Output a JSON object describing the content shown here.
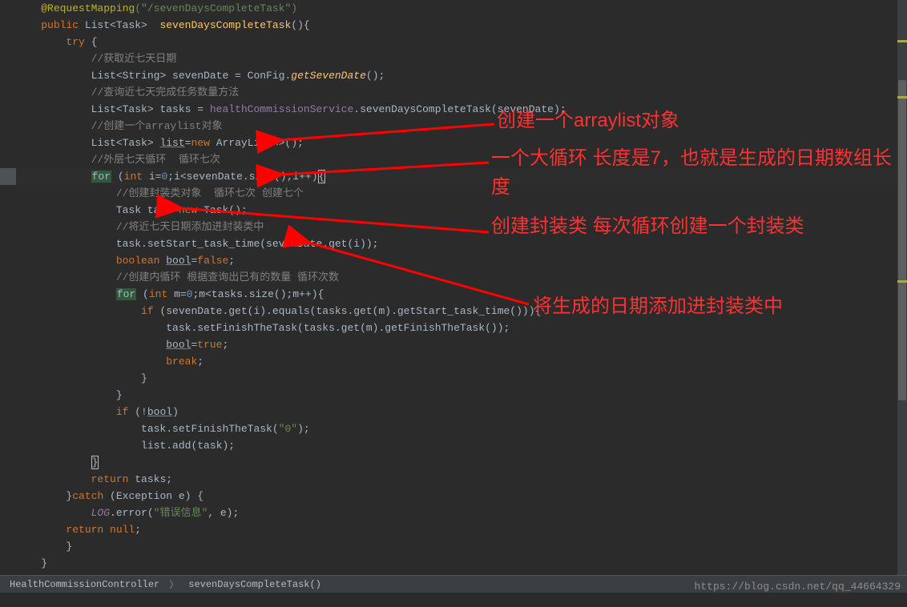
{
  "code": {
    "l1_anno": "@RequestMapping",
    "l1_str": "(\"/sevenDaysCompleteTask\")",
    "l2_kw": "public ",
    "l2_type": "List<Task>  ",
    "l2_method": "sevenDaysCompleteTask",
    "l2_end": "(){",
    "l3_try": "try ",
    "l3_brace": "{",
    "l4_comment": "//获取近七天日期",
    "l5_a": "List<String> sevenDate = ConFig.",
    "l5_b": "getSevenDate",
    "l5_c": "();",
    "l6_comment": "//查询近七天完成任务数量方法",
    "l7_a": "List<Task> tasks = ",
    "l7_b": "healthCommissionService",
    "l7_c": ".sevenDaysCompleteTask(sevenDate);",
    "l8_comment": "//创建一个arraylist对象",
    "l9_a": "List<Task> ",
    "l9_b": "list",
    "l9_c": "=",
    "l9_d": "new ",
    "l9_e": "ArrayList<>();",
    "l10_comment": "//外层七天循环  循环七次",
    "l11_for": "for",
    "l11_a": " (",
    "l11_b": "int ",
    "l11_c": "i=",
    "l11_d": "0",
    "l11_e": ";i<sevenDate.size();i++)",
    "l11_f": "{",
    "l12_comment": "//创建封装类对象  循环七次 创建七个",
    "l13_a": "Task task=",
    "l13_b": "new ",
    "l13_c": "Task();",
    "l14_comment": "//将近七天日期添加进封装类中",
    "l15_a": "task.setStart_task_time(sevenDate.get(i));",
    "l16_a": "boolean ",
    "l16_b": "bool",
    "l16_c": "=",
    "l16_d": "false",
    "l16_e": ";",
    "l17_comment": "//创建内循环 根据查询出已有的数量 循环次数",
    "l18_for": "for",
    "l18_a": " (",
    "l18_b": "int ",
    "l18_c": "m=",
    "l18_d": "0",
    "l18_e": ";m<tasks.size();m++){",
    "l19_a": "if ",
    "l19_b": "(sevenDate.get(i).equals(tasks.get(m).getStart_task_time())){",
    "l20_a": "task.setFinishTheTask(tasks.get(m).getFinishTheTask());",
    "l21_a": "bool",
    "l21_b": "=",
    "l21_c": "true",
    "l21_d": ";",
    "l22_a": "break",
    "l22_b": ";",
    "l23_brace": "}",
    "l24_brace": "}",
    "l25_a": "if ",
    "l25_b": "(!",
    "l25_c": "bool",
    "l25_d": ")",
    "l26_a": "task.setFinishTheTask(",
    "l26_b": "\"0\"",
    "l26_c": ");",
    "l27_a": "list.add(task);",
    "l28_brace": "}",
    "l29_a": "return ",
    "l29_b": "tasks;",
    "l30_a": "}",
    "l30_b": "catch ",
    "l30_c": "(Exception e) {",
    "l31_a": "LOG",
    "l31_b": ".error(",
    "l31_c": "\"错误信息\"",
    "l31_d": ", e);",
    "l32_a": "return null",
    "l32_b": ";",
    "l33_brace": "}",
    "l34_brace": "}"
  },
  "annotations": {
    "a1": "创建一个arraylist对象",
    "a2": "一个大循环 长度是7，也就是生成的日期数组长度",
    "a3": "创建封装类  每次循环创建一个封装类",
    "a4": "将生成的日期添加进封装类中"
  },
  "breadcrumb": {
    "item1": "HealthCommissionController",
    "item2": "sevenDaysCompleteTask()"
  },
  "watermark": "https://blog.csdn.net/qq_44664329"
}
